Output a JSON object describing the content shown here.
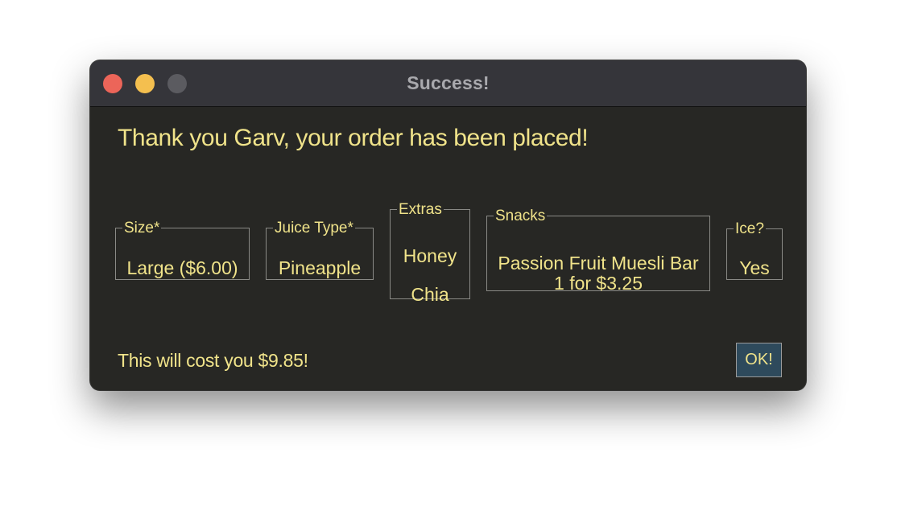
{
  "window": {
    "title": "Success!",
    "controls": {
      "close_icon": "close-traffic-light",
      "minimize_icon": "minimize-traffic-light",
      "maximize_icon": "maximize-traffic-light"
    }
  },
  "message": "Thank you Garv, your order has been placed!",
  "groups": {
    "size": {
      "label": "Size*",
      "value": "Large ($6.00)"
    },
    "juice": {
      "label": "Juice Type*",
      "value": "Pineapple"
    },
    "extras": {
      "label": "Extras",
      "items": [
        "Honey",
        "Chia"
      ]
    },
    "snacks": {
      "label": "Snacks",
      "line1": "Passion Fruit Muesli Bar",
      "line2": "1 for $3.25"
    },
    "ice": {
      "label": "Ice?",
      "value": "Yes"
    }
  },
  "footer": {
    "cost_text": "This will cost you $9.85!",
    "ok_label": "OK!"
  },
  "colors": {
    "background": "#272724",
    "titlebar": "#35353a",
    "text": "#f0e38a",
    "title_text": "#a9a9ad",
    "ok_button": "#2e4a5c",
    "close": "#ec6559",
    "minimize": "#f4bf4f",
    "maximize": "#5b5b60"
  }
}
